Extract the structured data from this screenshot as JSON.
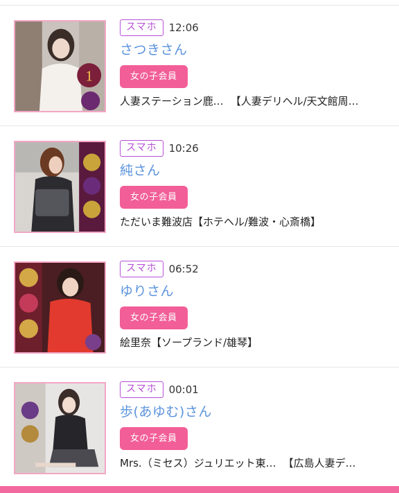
{
  "entries": [
    {
      "device": "スマホ",
      "time": "12:06",
      "name": "さつきさん",
      "badge": "女の子会員",
      "shop": "人妻ステーション鹿…",
      "genre": "【人妻デリヘル/天文館周…"
    },
    {
      "device": "スマホ",
      "time": "10:26",
      "name": "純さん",
      "badge": "女の子会員",
      "shop": "ただいま難波店",
      "genre": "【ホテヘル/難波・心斎橋】"
    },
    {
      "device": "スマホ",
      "time": "06:52",
      "name": "ゆりさん",
      "badge": "女の子会員",
      "shop": "絵里奈",
      "genre": "【ソープランド/雄琴】"
    },
    {
      "device": "スマホ",
      "time": "00:01",
      "name": "歩(あゆむ)さん",
      "badge": "女の子会員",
      "shop": "Mrs.（ミセス）ジュリエット東…",
      "genre": "【広島人妻デ…"
    }
  ]
}
